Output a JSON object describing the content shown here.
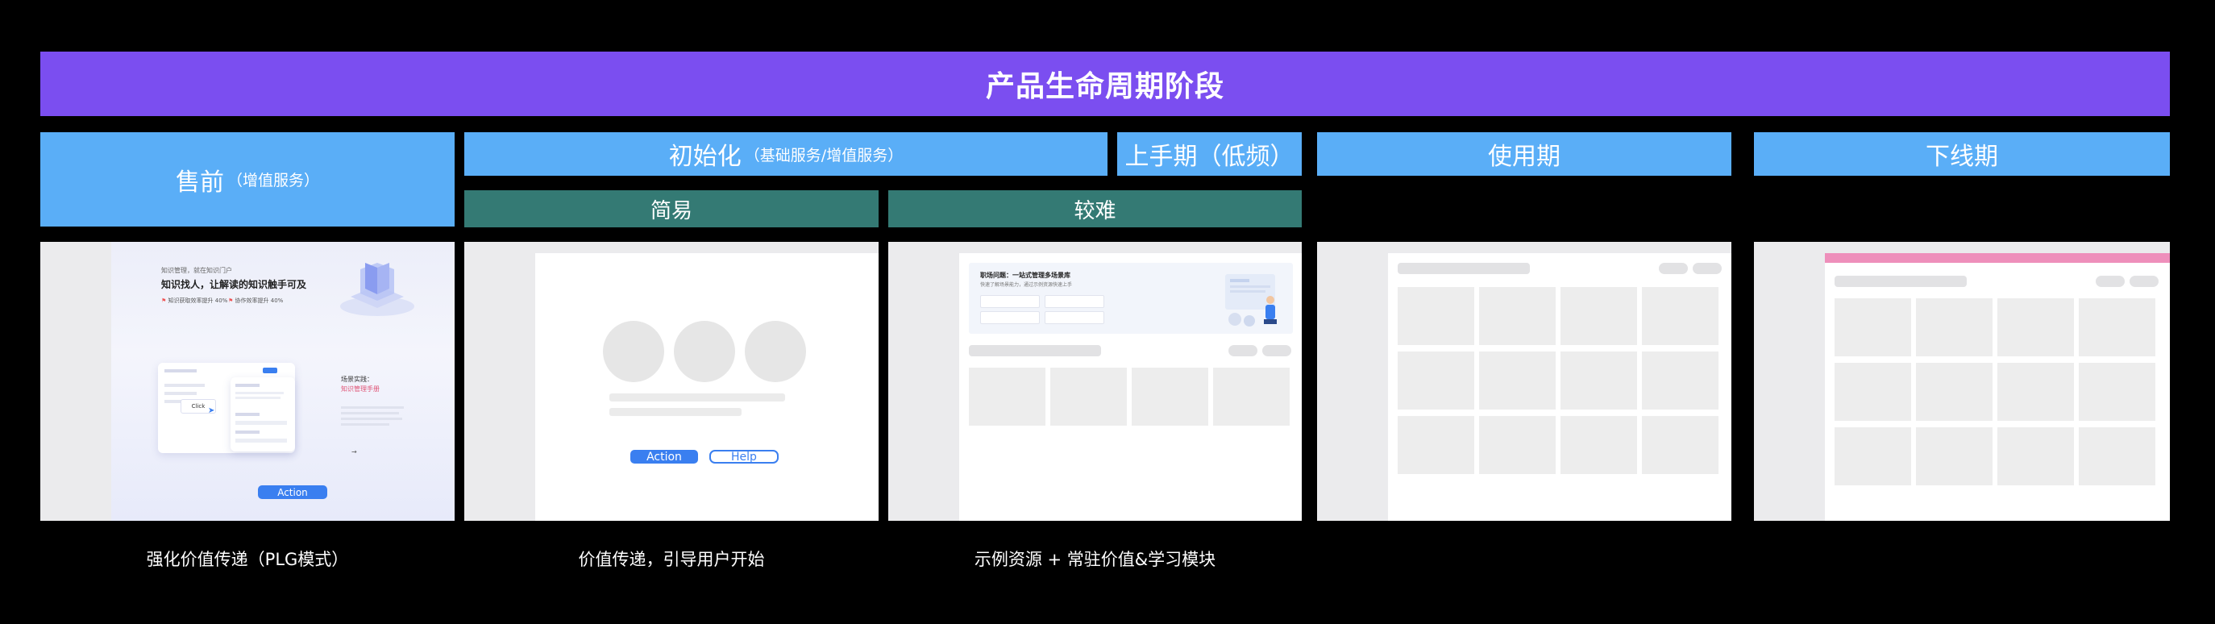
{
  "banner": {
    "title": "产品生命周期阶段"
  },
  "phases": {
    "presale": {
      "title": "售前",
      "note": "（增值服务）"
    },
    "init": {
      "title": "初始化",
      "note": "（基础服务/增值服务）"
    },
    "onboard": {
      "title": "上手期（低频）"
    },
    "usage": {
      "title": "使用期"
    },
    "offline": {
      "title": "下线期"
    }
  },
  "subphases": {
    "easy": "简易",
    "hard": "较难"
  },
  "captions": {
    "presale": "强化价值传递（PLG模式）",
    "easy": "价值传递，引导用户开始",
    "hard": "示例资源 + 常驻价值&学习模块"
  },
  "mock_presale": {
    "eyebrow": "知识管理，就在知识门户",
    "headline": "知识找人，让解读的知识触手可及",
    "stat1": "知识获取效率提升 40%",
    "stat2": "协作效率提升 40%",
    "side_title": "场景实践：",
    "side_subtitle": "知识管理手册",
    "click_label": "Click",
    "action_label": "Action"
  },
  "mock_easy": {
    "action_label": "Action",
    "help_label": "Help"
  },
  "mock_hard": {
    "headline": "职场问题：一站式管理多场景库",
    "sub": "快速了解场景能力，通过示例资源快速上手"
  },
  "colors": {
    "banner": "#7b4ef0",
    "phase": "#5aaef7",
    "subphase": "#347a74",
    "accent": "#3a7ff0",
    "pink": "#ee8fbb"
  }
}
